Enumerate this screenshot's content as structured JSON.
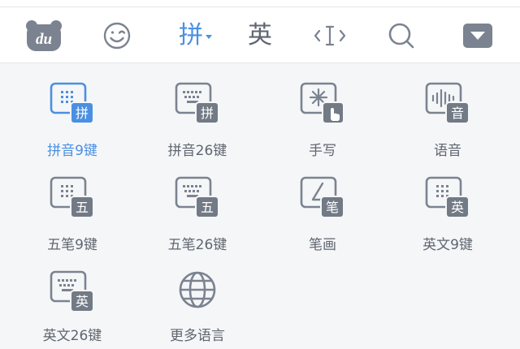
{
  "colors": {
    "accent": "#4a90e2",
    "icon": "#7b8390",
    "label": "#5f6670",
    "badge": "#727a86",
    "panel_bg": "#f5f6f8"
  },
  "toolbar": {
    "logo_text": "du",
    "pinyin_label": "拼",
    "english_label": "英"
  },
  "modes": [
    {
      "label": "拼音9键",
      "badge": "拼",
      "icon": "keyboard-icon",
      "selected": true
    },
    {
      "label": "拼音26键",
      "badge": "拼",
      "icon": "keyboard-icon",
      "selected": false
    },
    {
      "label": "手写",
      "icon": "handwriting-icon",
      "selected": false
    },
    {
      "label": "语音",
      "badge": "音",
      "icon": "voice-icon",
      "selected": false
    },
    {
      "label": "五笔9键",
      "badge": "五",
      "icon": "keyboard-icon",
      "selected": false
    },
    {
      "label": "五笔26键",
      "badge": "五",
      "icon": "keyboard-icon",
      "selected": false
    },
    {
      "label": "笔画",
      "badge": "笔",
      "icon": "stroke-icon",
      "selected": false
    },
    {
      "label": "英文9键",
      "badge": "英",
      "icon": "keyboard-icon",
      "selected": false
    },
    {
      "label": "英文26键",
      "badge": "英",
      "icon": "keyboard-icon",
      "selected": false
    },
    {
      "label": "更多语言",
      "icon": "globe-icon",
      "selected": false
    }
  ]
}
